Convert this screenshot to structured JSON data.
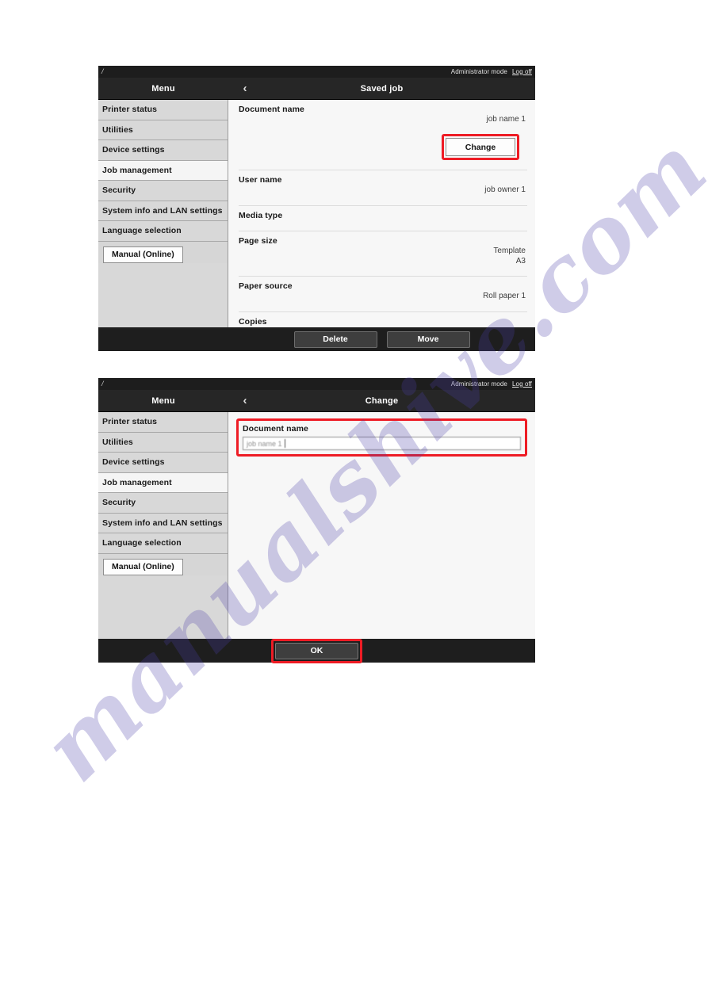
{
  "watermark": {
    "text": "manualshive.com"
  },
  "screens": [
    {
      "id": "saved-job",
      "topbar": {
        "slash": "/",
        "admin_label": "Administrator mode",
        "logoff_label": "Log off"
      },
      "header": {
        "menu_label": "Menu",
        "back_icon": "‹",
        "title": "Saved job"
      },
      "sidebar": {
        "items": [
          {
            "label": "Printer status",
            "active": false
          },
          {
            "label": "Utilities",
            "active": false
          },
          {
            "label": "Device settings",
            "active": false
          },
          {
            "label": "Job management",
            "active": true
          },
          {
            "label": "Security",
            "active": false
          },
          {
            "label": "System info and LAN settings",
            "active": false
          },
          {
            "label": "Language selection",
            "active": false
          }
        ],
        "manual_button": "Manual (Online)"
      },
      "details": [
        {
          "label": "Document name",
          "value": "job name 1"
        },
        {
          "label": "User name",
          "value": "job owner 1"
        },
        {
          "label": "Media type",
          "value": ""
        },
        {
          "label": "Page size",
          "value": "Template\nA3"
        },
        {
          "label": "Paper source",
          "value": "Roll paper 1"
        },
        {
          "label": "Copies",
          "value": ""
        }
      ],
      "page_size_value_line1": "Template",
      "page_size_value_line2": "A3",
      "change_button": "Change",
      "footer": {
        "delete_label": "Delete",
        "move_label": "Move"
      }
    },
    {
      "id": "change",
      "topbar": {
        "slash": "/",
        "admin_label": "Administrator mode",
        "logoff_label": "Log off"
      },
      "header": {
        "menu_label": "Menu",
        "back_icon": "‹",
        "title": "Change"
      },
      "sidebar": {
        "items": [
          {
            "label": "Printer status",
            "active": false
          },
          {
            "label": "Utilities",
            "active": false
          },
          {
            "label": "Device settings",
            "active": false
          },
          {
            "label": "Job management",
            "active": true
          },
          {
            "label": "Security",
            "active": false
          },
          {
            "label": "System info and LAN settings",
            "active": false
          },
          {
            "label": "Language selection",
            "active": false
          }
        ],
        "manual_button": "Manual (Online)"
      },
      "form": {
        "field_label": "Document name",
        "field_value": "job name 1"
      },
      "footer": {
        "ok_label": "OK"
      }
    }
  ],
  "colors": {
    "highlight_red": "#ee1c25",
    "header_dark": "#262626",
    "sidebar_grey": "#d8d8d8",
    "content_grey": "#f7f7f7"
  }
}
